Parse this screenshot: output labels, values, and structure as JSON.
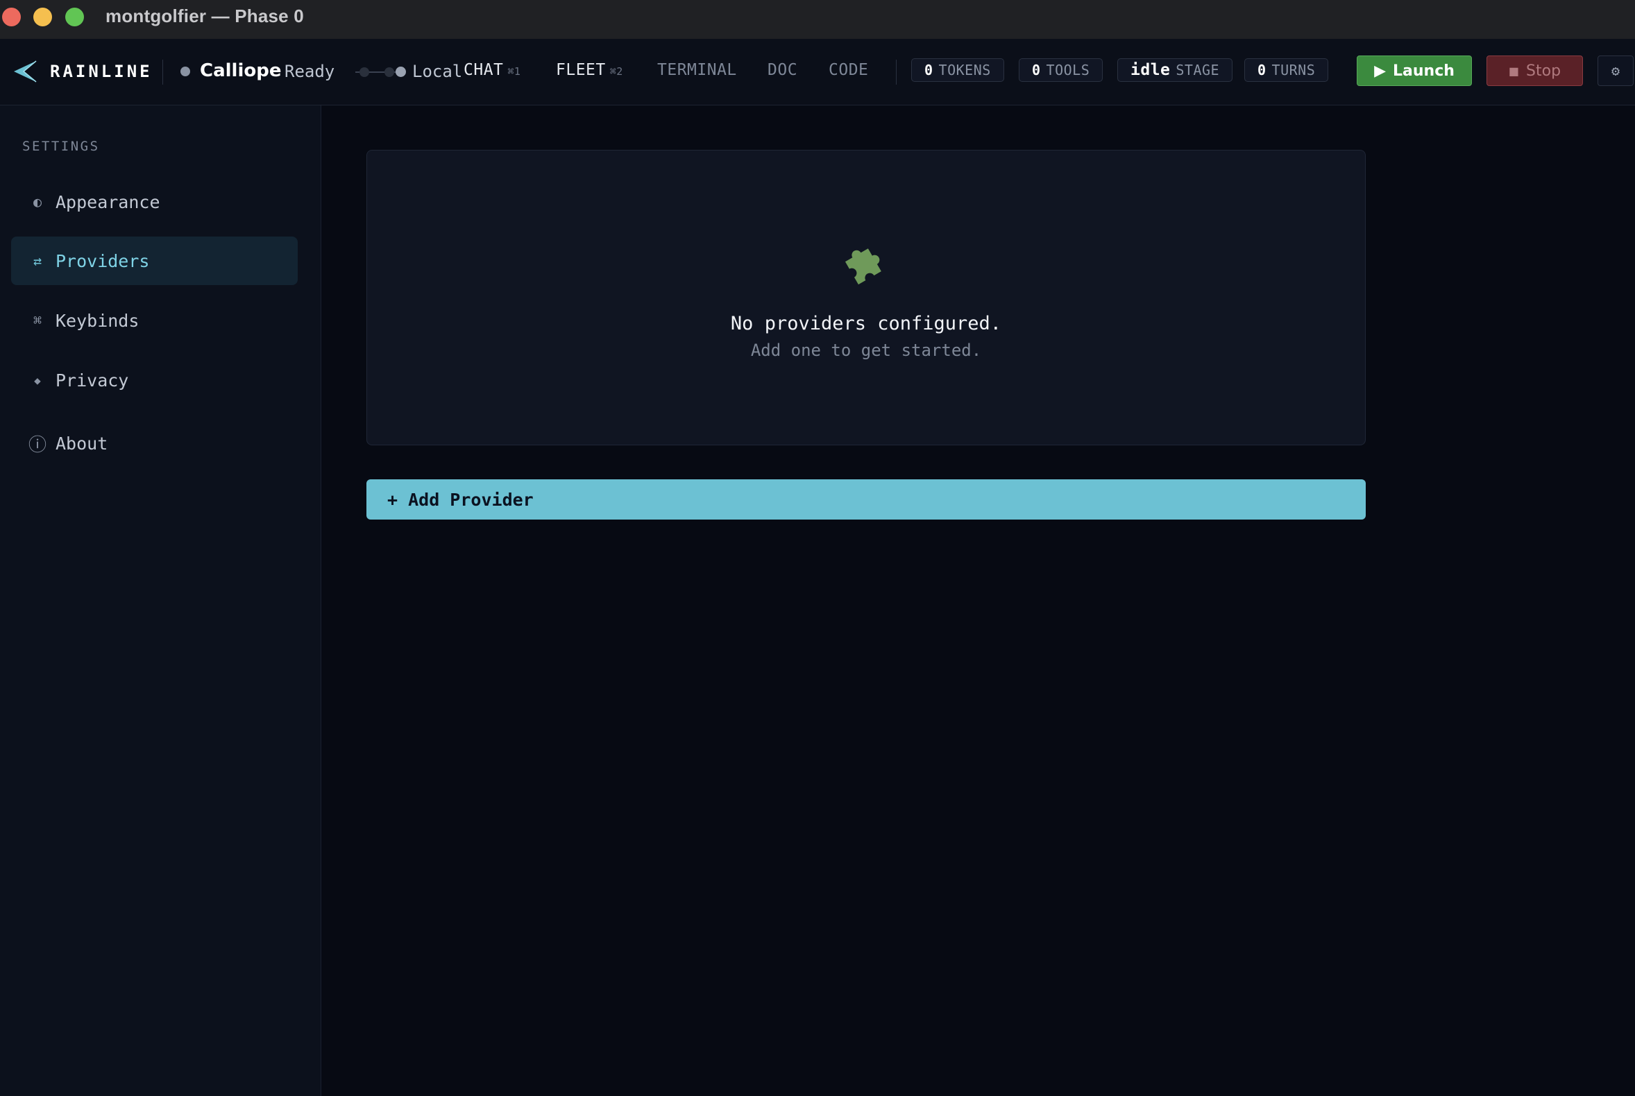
{
  "window": {
    "title": "montgolfier — Phase 0"
  },
  "brand": {
    "name": "RAINLINE"
  },
  "agent": {
    "name": "Calliope",
    "status": "Ready",
    "connection": "Local"
  },
  "tabs": [
    {
      "label": "CHAT",
      "shortcut": "⌘1",
      "active": true
    },
    {
      "label": "FLEET",
      "shortcut": "⌘2",
      "active": true
    },
    {
      "label": "TERMINAL",
      "shortcut": "",
      "active": false
    },
    {
      "label": "DOC",
      "shortcut": "",
      "active": false
    },
    {
      "label": "CODE",
      "shortcut": "",
      "active": false
    }
  ],
  "stats": {
    "tokens": {
      "value": "0",
      "label": "TOKENS"
    },
    "tools": {
      "value": "0",
      "label": "TOOLS"
    },
    "stage": {
      "value": "idle",
      "label": "STAGE"
    },
    "turns": {
      "value": "0",
      "label": "TURNS"
    }
  },
  "actions": {
    "launch": "Launch",
    "stop": "Stop",
    "settings_icon": "gear-icon"
  },
  "sidebar": {
    "heading": "SETTINGS",
    "items": [
      {
        "label": "Appearance",
        "icon": "◐",
        "active": false
      },
      {
        "label": "Providers",
        "icon": "⇄",
        "active": true
      },
      {
        "label": "Keybinds",
        "icon": "⌘",
        "active": false
      },
      {
        "label": "Privacy",
        "icon": "◆",
        "active": false
      },
      {
        "label": "About",
        "icon": "ⓘ",
        "active": false
      }
    ]
  },
  "providers": {
    "empty_title": "No providers configured.",
    "empty_subtitle": "Add one to get started.",
    "add_button": "+ Add Provider"
  },
  "colors": {
    "accent": "#6cc1d3",
    "launch": "#3b8a3e",
    "stop": "#5a2127",
    "background": "#070a13"
  }
}
